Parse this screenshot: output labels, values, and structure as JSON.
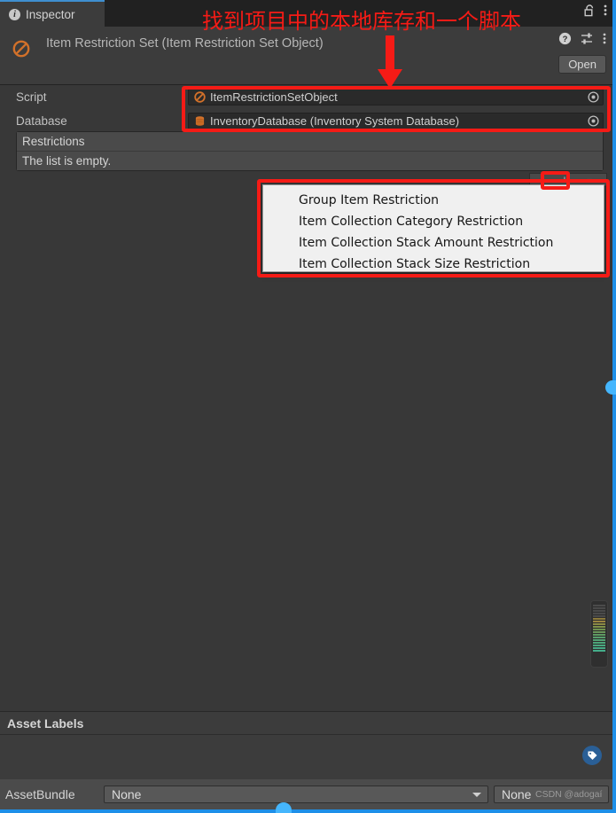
{
  "window": {
    "accent_color": "#1e8fe8",
    "background": "#383838",
    "panel_background": "#3c3c3c"
  },
  "tabstrip": {
    "tab_label": "Inspector",
    "info_icon": "info-icon",
    "lock_icon": "unlocked-padlock-icon",
    "menu_icon": "kebab-menu-icon"
  },
  "header": {
    "object_icon": "prohibited-sign-icon",
    "title": "Item Restriction Set (Item Restriction Set Object)",
    "help_icon": "help-icon",
    "preset_icon": "preset-settings-icon",
    "menu_icon": "kebab-menu-icon",
    "open_label": "Open"
  },
  "fields": [
    {
      "label": "Script",
      "icon": "script-prohibited-icon",
      "value": "ItemRestrictionSetObject",
      "picker_icon": "object-picker-icon"
    },
    {
      "label": "Database",
      "icon": "database-icon",
      "value": "InventoryDatabase (Inventory System Database)",
      "picker_icon": "object-picker-icon"
    }
  ],
  "restrictions_list": {
    "header": "Restrictions",
    "empty_text": "The list is empty.",
    "add_label": "+",
    "remove_label": "−"
  },
  "dropdown": {
    "items": [
      "Group Item Restriction",
      "Item Collection Category Restriction",
      "Item Collection Stack Amount Restriction",
      "Item Collection Stack Size Restriction"
    ]
  },
  "annotations": {
    "note_text": "找到项目中的本地库存和一个脚本",
    "color": "#f51b16",
    "arrow": "down-arrow-annotation"
  },
  "footer": {
    "asset_labels_title": "Asset Labels",
    "tag_icon": "tag-icon",
    "assetbundle_label": "AssetBundle",
    "assetbundle_value": "None",
    "variant_value": "None",
    "watermark": "CSDN @adogaí"
  }
}
